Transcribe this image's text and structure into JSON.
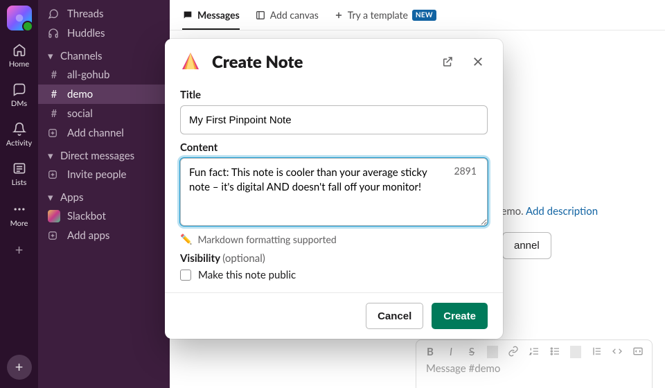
{
  "rail": {
    "items": [
      {
        "name": "home",
        "label": "Home"
      },
      {
        "name": "dms",
        "label": "DMs"
      },
      {
        "name": "activity",
        "label": "Activity"
      },
      {
        "name": "lists",
        "label": "Lists"
      },
      {
        "name": "more",
        "label": "More"
      }
    ]
  },
  "sidebar": {
    "threads": "Threads",
    "huddles": "Huddles",
    "sections": {
      "channels": {
        "label": "Channels",
        "items": [
          {
            "name": "all-gohub",
            "label": "all-gohub"
          },
          {
            "name": "demo",
            "label": "demo",
            "selected": true
          },
          {
            "name": "social",
            "label": "social"
          }
        ],
        "add": "Add channel"
      },
      "dms": {
        "label": "Direct messages",
        "invite": "Invite people"
      },
      "apps": {
        "label": "Apps",
        "slackbot": "Slackbot",
        "add": "Add apps"
      }
    }
  },
  "main": {
    "tabs": [
      {
        "id": "messages",
        "label": "Messages",
        "active": true
      },
      {
        "id": "canvas",
        "label": "Add canvas"
      },
      {
        "id": "template",
        "label": "Try a template",
        "badge": "NEW"
      }
    ],
    "blurb_mid": " demo. ",
    "blurb_link": "Add description",
    "add_to_channel": "annel",
    "composer_placeholder": "Message #demo"
  },
  "modal": {
    "title": "Create Note",
    "title_field_label": "Title",
    "title_value": "My First Pinpoint Note",
    "content_label": "Content",
    "content_value": "Fun fact: This note is cooler than your average sticky note – it's digital AND doesn't fall off your monitor!",
    "char_remaining": "2891",
    "helper": "Markdown formatting supported",
    "visibility_label": "Visibility ",
    "visibility_optional": "(optional)",
    "visibility_checkbox": "Make this note public",
    "cancel": "Cancel",
    "submit": "Create"
  },
  "colors": {
    "primary_green": "#007a5a",
    "focus_blue": "#1c9bd1",
    "link_blue": "#1264a3"
  }
}
